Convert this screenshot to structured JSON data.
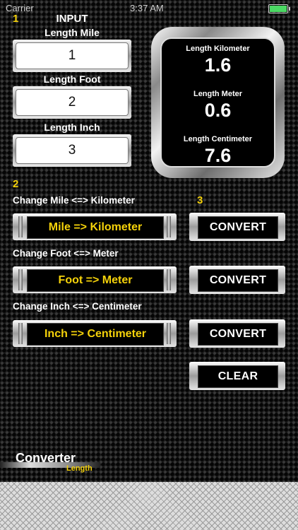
{
  "status": {
    "carrier": "Carrier",
    "time": "3:37 AM"
  },
  "steps": {
    "one": "1",
    "two": "2",
    "three": "3"
  },
  "input": {
    "title": "INPUT",
    "mile_label": "Length Mile",
    "mile_value": "1",
    "foot_label": "Length  Foot",
    "foot_value": "2",
    "inch_label": "Length Inch",
    "inch_value": "3"
  },
  "results": {
    "km_label": "Length Kilometer",
    "km_value": "1.6",
    "m_label": "Length Meter",
    "m_value": "0.6",
    "cm_label": "Length Centimeter",
    "cm_value": "7.6"
  },
  "modes": [
    {
      "caption": "Change  Mile <=> Kilometer",
      "button": "Mile => Kilometer"
    },
    {
      "caption": "Change  Foot <=> Meter",
      "button": "Foot => Meter"
    },
    {
      "caption": "Change  Inch <=> Centimeter",
      "button": "Inch => Centimeter"
    }
  ],
  "actions": {
    "convert": "CONVERT",
    "clear": "CLEAR"
  },
  "logo": {
    "title": "Converter",
    "subtitle": "Length"
  },
  "colors": {
    "accent": "#f5d20a",
    "battery": "#4cd964"
  }
}
